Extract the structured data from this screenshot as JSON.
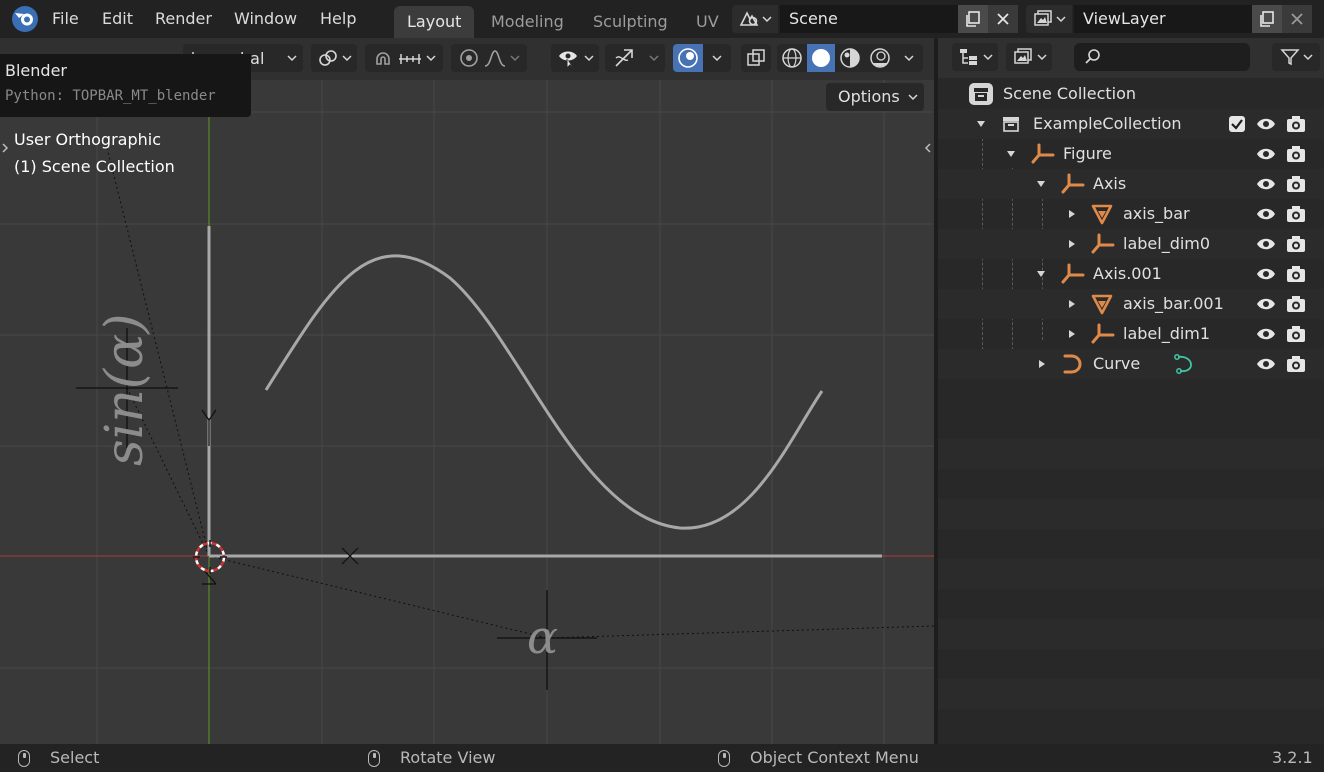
{
  "topbar": {
    "menu": [
      "File",
      "Edit",
      "Render",
      "Window",
      "Help"
    ],
    "workspaces": [
      {
        "label": "Layout",
        "active": true
      },
      {
        "label": "Modeling",
        "active": false
      },
      {
        "label": "Sculpting",
        "active": false
      },
      {
        "label": "UV",
        "active": false
      }
    ],
    "scene_name": "Scene",
    "view_layer_name": "ViewLayer"
  },
  "viewport": {
    "transform_orientation_partial": "bal",
    "options_label": "Options",
    "view_name": "User Orthographic",
    "collection_info": "(1) Scene Collection",
    "axis_label_y": "sin(α)",
    "axis_label_x": "α"
  },
  "tooltip": {
    "title": "Blender",
    "python": "Python: TOPBAR_MT_blender"
  },
  "outliner": {
    "root": "Scene Collection",
    "items": [
      {
        "label": "ExampleCollection",
        "icon": "collection-icon",
        "checked": true
      },
      {
        "label": "Figure",
        "icon": "empty-icon"
      },
      {
        "label": "Axis",
        "icon": "empty-icon"
      },
      {
        "label": "axis_bar",
        "icon": "mesh-icon"
      },
      {
        "label": "label_dim0",
        "icon": "empty-icon"
      },
      {
        "label": "Axis.001",
        "icon": "empty-icon"
      },
      {
        "label": "axis_bar.001",
        "icon": "mesh-icon"
      },
      {
        "label": "label_dim1",
        "icon": "empty-icon"
      },
      {
        "label": "Curve",
        "icon": "curve-icon"
      }
    ]
  },
  "statusbar": {
    "select": "Select",
    "rotate": "Rotate View",
    "context": "Object Context Menu",
    "version": "3.2.1"
  },
  "colors": {
    "accent_blue": "#4772b3",
    "object_orange": "#e08a4a",
    "curve_data_green": "#3fc4a4",
    "x_axis_red": "#9a3a3a",
    "y_axis_green": "#5a8a2a"
  }
}
